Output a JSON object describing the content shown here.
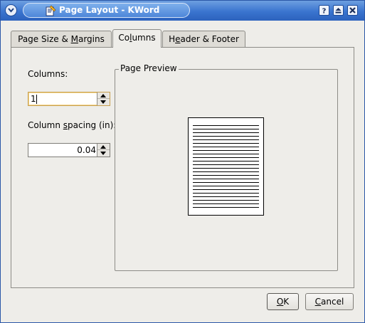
{
  "window": {
    "title": "Page Layout - KWord"
  },
  "titlebar": {
    "menu_icon": "chevron-down-icon",
    "app_icon": "kword-icon",
    "help_icon": "help-icon",
    "shade_icon": "shade-icon",
    "close_icon": "close-icon"
  },
  "tabs": [
    {
      "pre": "Page Size & ",
      "acc": "M",
      "post": "argins",
      "active": false
    },
    {
      "pre": "Co",
      "acc": "l",
      "post": "umns",
      "active": true
    },
    {
      "pre": "H",
      "acc": "e",
      "post": "ader & Footer",
      "active": false
    }
  ],
  "columns": {
    "label": "Columns:",
    "value": "1",
    "spacing_label_pre": "Column ",
    "spacing_label_acc": "s",
    "spacing_label_post": "pacing (in):",
    "spacing_value": "0.04"
  },
  "preview": {
    "title": "Page Preview"
  },
  "buttons": {
    "ok_acc": "O",
    "ok_post": "K",
    "cancel_acc": "C",
    "cancel_post": "ancel"
  },
  "colors": {
    "titlebar": "#3a74cf",
    "window_bg": "#eeede9",
    "focus_border": "#c8a050"
  }
}
